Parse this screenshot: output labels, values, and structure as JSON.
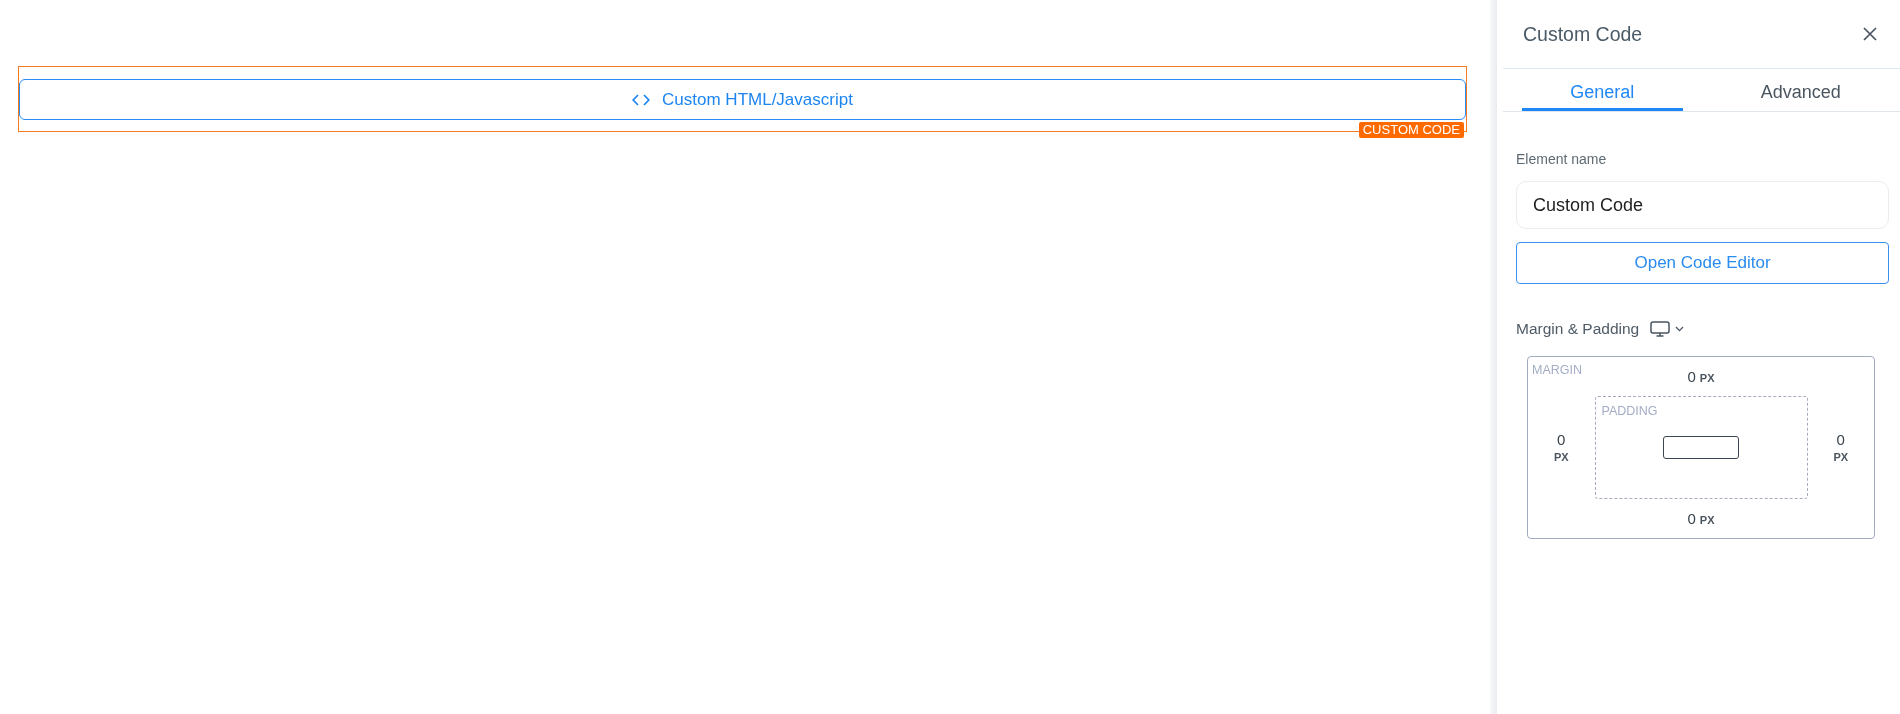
{
  "canvas": {
    "element": {
      "label": "Custom HTML/Javascript",
      "selected": true,
      "badge": "CUSTOM CODE"
    }
  },
  "panel": {
    "title": "Custom Code",
    "tabs": [
      {
        "label": "General",
        "selected": true
      },
      {
        "label": "Advanced",
        "selected": false
      }
    ],
    "element_name": {
      "label": "Element name",
      "value": "Custom Code"
    },
    "editor_button": {
      "label": "Open Code Editor"
    },
    "spacing": {
      "label": "Margin & Padding",
      "margin": {
        "label": "MARGIN",
        "top": {
          "value": "0",
          "unit": "PX"
        },
        "right": {
          "value": "0",
          "unit": "PX"
        },
        "bottom": {
          "value": "0",
          "unit": "PX"
        },
        "left": {
          "value": "0",
          "unit": "PX"
        }
      },
      "padding": {
        "label": "PADDING"
      }
    }
  }
}
